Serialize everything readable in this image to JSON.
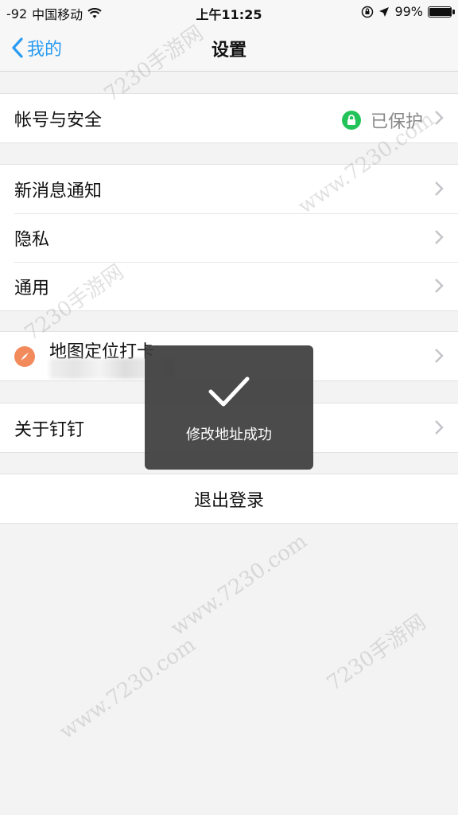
{
  "status_bar": {
    "signal": "-92",
    "carrier": "中国移动",
    "time": "上午11:25",
    "battery": "99%",
    "battery_level": 0.99
  },
  "nav": {
    "back_label": "我的",
    "title": "设置"
  },
  "groups": {
    "account": {
      "label": "帐号与安全",
      "value": "已保护"
    },
    "general": [
      {
        "label": "新消息通知"
      },
      {
        "label": "隐私"
      },
      {
        "label": "通用"
      }
    ],
    "checkin": {
      "label": "地图定位打卡"
    },
    "about": {
      "label": "关于钉钉"
    },
    "logout": {
      "label": "退出登录"
    }
  },
  "toast": {
    "message": "修改地址成功"
  },
  "watermark": {
    "text1": "7230手游网",
    "text2": "www.7230.com"
  },
  "colors": {
    "accent": "#2a9bf0",
    "lock": "#24c35a",
    "compass": "#f38a5c"
  },
  "icons": [
    "wifi-icon",
    "lock-rotation-icon",
    "location-arrow-icon",
    "battery-icon",
    "back-chevron-icon",
    "lock-icon",
    "compass-icon",
    "chevron-right-icon",
    "checkmark-icon"
  ]
}
